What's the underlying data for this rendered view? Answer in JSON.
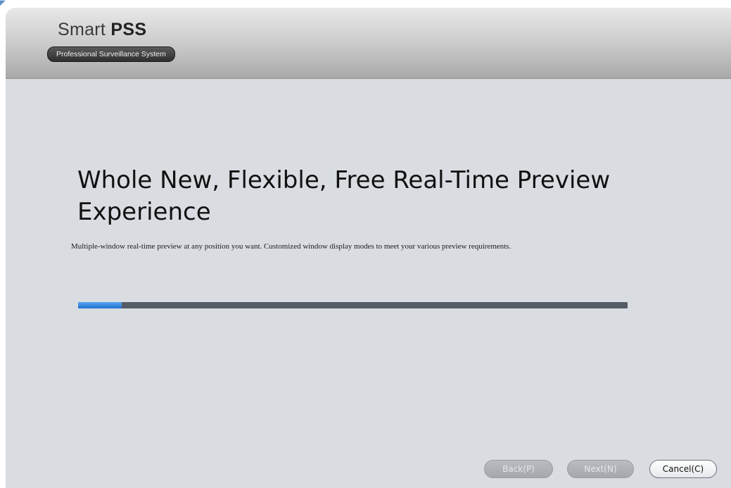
{
  "header": {
    "title_prefix": "Smart ",
    "title_bold": "PSS",
    "subtitle": "Professional Surveillance System"
  },
  "main": {
    "headline": "Whole New, Flexible, Free Real-Time Preview Experience",
    "description": "Multiple-window real-time preview at any position you want. Customized window display modes to meet your various preview requirements.",
    "progress_fraction": 0.08
  },
  "buttons": {
    "back_label": "Back(P)",
    "next_label": "Next(N)",
    "cancel_label": "Cancel(C)"
  },
  "colors": {
    "progress_fill": "#1e6fd0",
    "progress_track": "#545c66",
    "background": "#d9dde2"
  }
}
